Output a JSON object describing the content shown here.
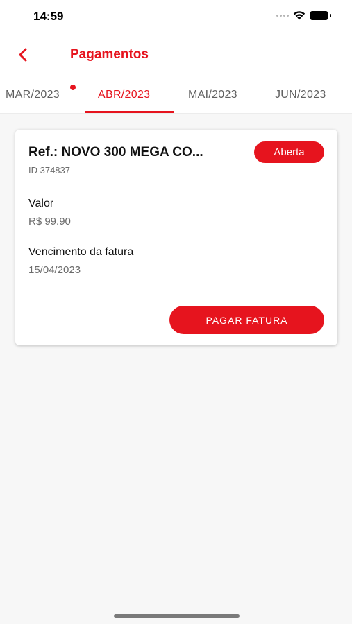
{
  "status_bar": {
    "time": "14:59",
    "icons": [
      "signal-dots-icon",
      "wifi-icon",
      "battery-icon"
    ]
  },
  "header": {
    "back_icon": "chevron-left-icon",
    "title": "Pagamentos"
  },
  "tabs": [
    {
      "label": "MAR/2023",
      "active": false,
      "has_dot": true
    },
    {
      "label": "ABR/2023",
      "active": true,
      "has_dot": false
    },
    {
      "label": "MAI/2023",
      "active": false,
      "has_dot": false
    },
    {
      "label": "JUN/2023",
      "active": false,
      "has_dot": false
    }
  ],
  "invoice": {
    "ref": "Ref.: NOVO 300 MEGA CO...",
    "id": "ID 374837",
    "status": "Aberta",
    "valor_label": "Valor",
    "valor": "R$ 99.90",
    "vencimento_label": "Vencimento da fatura",
    "vencimento": "15/04/2023",
    "pay_button": "PAGAR FATURA"
  },
  "colors": {
    "accent": "#e6141e",
    "background": "#f7f7f7"
  }
}
